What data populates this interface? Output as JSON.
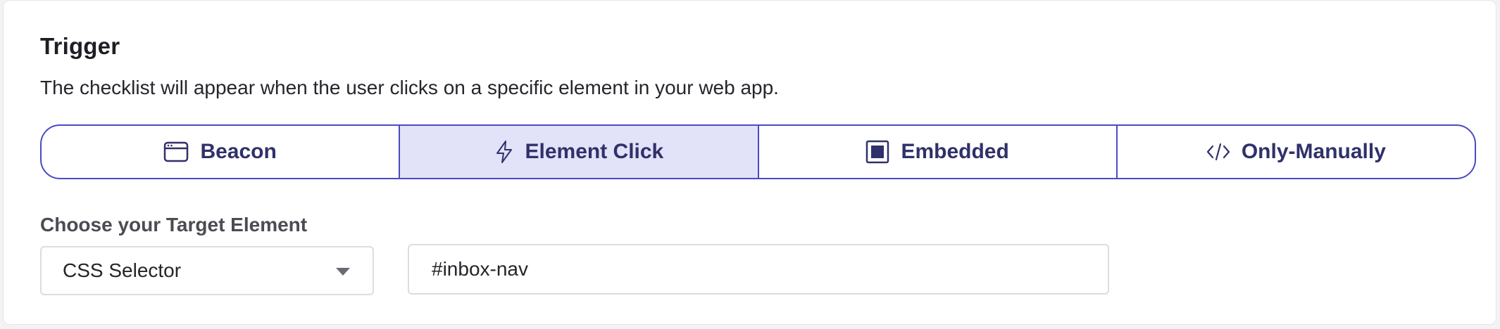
{
  "section": {
    "title": "Trigger",
    "description": "The checklist will appear when the user clicks on a specific element in your web app."
  },
  "tabs": [
    {
      "label": "Beacon",
      "icon": "browser-window-icon",
      "active": false
    },
    {
      "label": "Element Click",
      "icon": "lightning-icon",
      "active": true
    },
    {
      "label": "Embedded",
      "icon": "embedded-square-icon",
      "active": false
    },
    {
      "label": "Only-Manually",
      "icon": "code-icon",
      "active": false
    }
  ],
  "target": {
    "label": "Choose your Target Element",
    "selector_type": "CSS Selector",
    "selector_value": "#inbox-nav"
  },
  "colors": {
    "accent": "#4b4bc2",
    "active_tab_bg": "#e2e2f8",
    "tab_text": "#30306a"
  }
}
